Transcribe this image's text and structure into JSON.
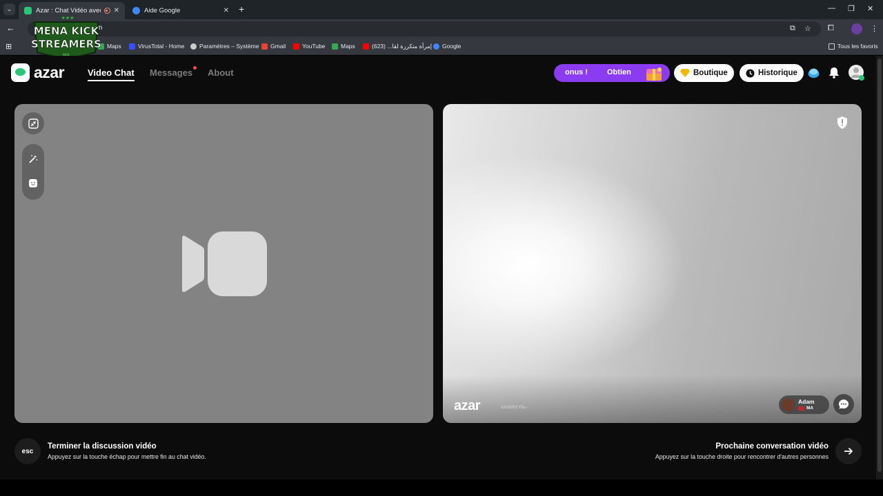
{
  "browser": {
    "tabs": [
      {
        "title": "Azar : Chat Vidéo avec de n",
        "favicon_color": "#28c776",
        "active": true
      },
      {
        "title": "Aide Google",
        "favicon_color": "#4285f4",
        "active": false
      }
    ],
    "new_tab_label": "+",
    "url": "m",
    "bookmarks": [
      {
        "label": "Maps",
        "icon_color": "#34a853"
      },
      {
        "label": "VirusTotal - Home",
        "icon_color": "#394eff"
      },
      {
        "label": "Paramètres – Système",
        "icon_color": "#cccccc"
      },
      {
        "label": "Gmail",
        "icon_color": "#ea4335"
      },
      {
        "label": "YouTube",
        "icon_color": "#ff0000"
      },
      {
        "label": "Maps",
        "icon_color": "#34a853"
      },
      {
        "label": "إمرأة متكررة لقا... (623)",
        "icon_color": "#ff0000"
      },
      {
        "label": "Google",
        "icon_color": "#4285f4"
      }
    ],
    "all_bookmarks_label": "Tous les favoris"
  },
  "overlay": {
    "line1": "MENA KICK",
    "line2": "STREAMERS",
    "small": "KICK"
  },
  "header": {
    "logo_text": "azar",
    "nav": [
      {
        "label": "Video Chat",
        "active": true
      },
      {
        "label": "Messages",
        "active": false,
        "notification": true
      },
      {
        "label": "About",
        "active": false
      }
    ],
    "promo_text_1": "onus !",
    "promo_text_2": "Obtien",
    "shop_label": "Boutique",
    "history_label": "Historique"
  },
  "remote": {
    "watermark": "azar",
    "watermark_id": "AXVKR3 Y9s –",
    "user_name": "Adam",
    "country_code": "MA"
  },
  "footer": {
    "esc_label": "esc",
    "end_title": "Terminer la discussion vidéo",
    "end_sub": "Appuyez sur la touche échap pour mettre fin au chat vidéo.",
    "next_title": "Prochaine conversation vidéo",
    "next_sub": "Appuyez sur la touche droite pour rencontrer d'autres personnes"
  },
  "colors": {
    "brand_green": "#28c776",
    "promo_purple": "#8b3cf0",
    "page_bg": "#0c0c0c",
    "local_panel": "#838383"
  }
}
